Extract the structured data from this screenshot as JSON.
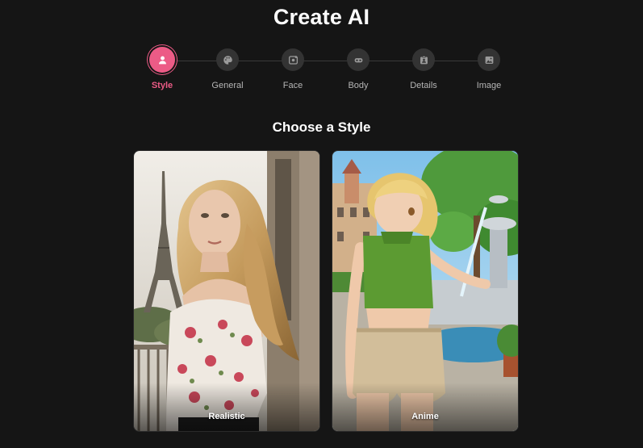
{
  "header": {
    "title": "Create AI"
  },
  "stepper": {
    "active_color": "#ec5b86",
    "steps": [
      {
        "label": "Style",
        "icon": "person-icon",
        "active": true
      },
      {
        "label": "General",
        "icon": "palette-icon",
        "active": false
      },
      {
        "label": "Face",
        "icon": "face-icon",
        "active": false
      },
      {
        "label": "Body",
        "icon": "body-icon",
        "active": false
      },
      {
        "label": "Details",
        "icon": "id-card-icon",
        "active": false
      },
      {
        "label": "Image",
        "icon": "image-icon",
        "active": false
      }
    ]
  },
  "main": {
    "heading": "Choose a Style",
    "styles": [
      {
        "label": "Realistic",
        "image": "realistic-woman-paris-photo"
      },
      {
        "label": "Anime",
        "image": "anime-girl-fountain-illustration"
      }
    ]
  }
}
